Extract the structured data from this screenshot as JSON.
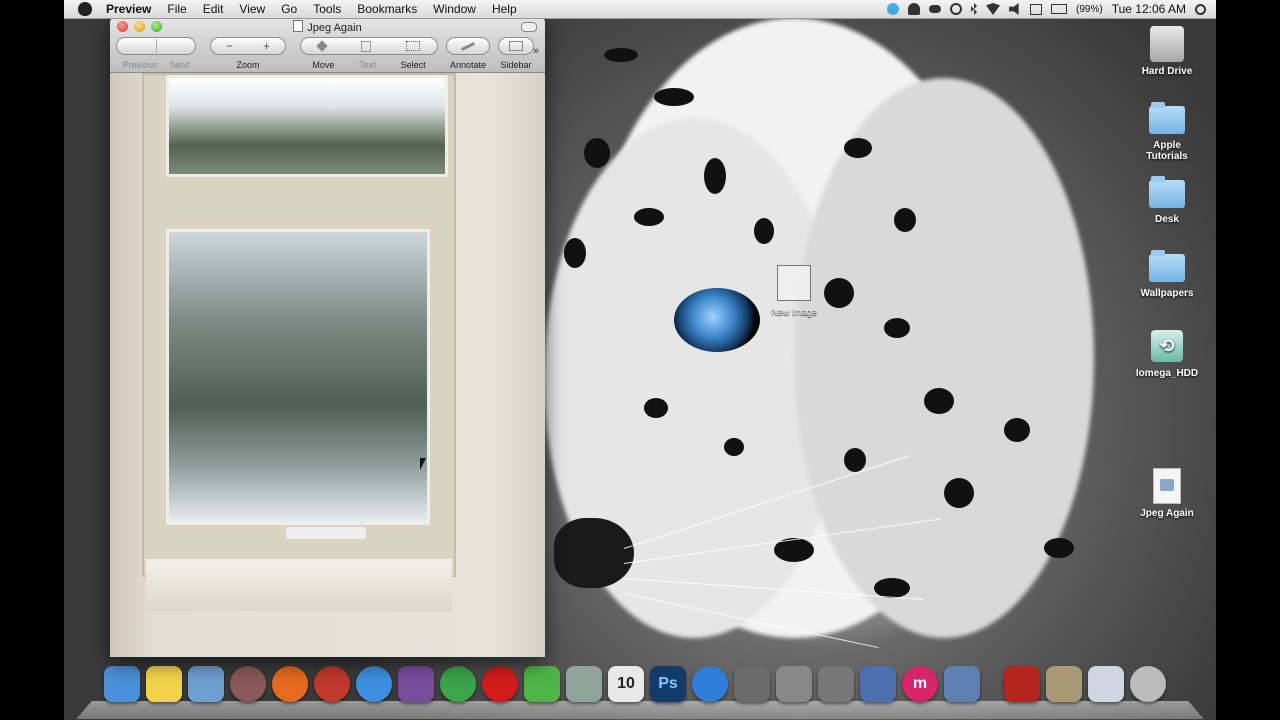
{
  "menubar": {
    "app": "Preview",
    "items": [
      "File",
      "Edit",
      "View",
      "Go",
      "Tools",
      "Bookmarks",
      "Window",
      "Help"
    ],
    "battery": "(99%)",
    "clock": "Tue 12:06 AM"
  },
  "window": {
    "title": "Jpeg Again",
    "toolbar": {
      "previous": "Previous",
      "next": "Next",
      "zoom": "Zoom",
      "zoom_out_glyph": "−",
      "zoom_in_glyph": "+",
      "move": "Move",
      "text": "Text",
      "select": "Select",
      "annotate": "Annotate",
      "sidebar": "Sidebar",
      "overflow": "»"
    }
  },
  "desktop": {
    "icons": [
      {
        "label": "Hard Drive",
        "kind": "drive"
      },
      {
        "label": "Apple Tutorials",
        "kind": "folder"
      },
      {
        "label": "Desk",
        "kind": "folder"
      },
      {
        "label": "Wallpapers",
        "kind": "folder"
      },
      {
        "label": "Iomega_HDD",
        "kind": "timemachine"
      },
      {
        "label": "Jpeg Again",
        "kind": "file"
      }
    ],
    "dragged_item": "New Image"
  },
  "dock": {
    "apps": [
      {
        "name": "finder-icon",
        "color": "#4a90d9"
      },
      {
        "name": "stickies-icon",
        "color": "#f2d34a"
      },
      {
        "name": "preview-icon",
        "color": "#6f9fd0"
      },
      {
        "name": "itunes-dvd-icon",
        "color": "#8a5a5a"
      },
      {
        "name": "firefox-icon",
        "color": "#e66a1f"
      },
      {
        "name": "half-life-icon",
        "color": "#c0392b"
      },
      {
        "name": "safari-icon",
        "color": "#3f8fe0"
      },
      {
        "name": "tor-icon",
        "color": "#7a4d9c"
      },
      {
        "name": "chrome-icon",
        "color": "#3aa54a"
      },
      {
        "name": "opera-icon",
        "color": "#d21b1b"
      },
      {
        "name": "leaf-icon",
        "color": "#4fb548"
      },
      {
        "name": "activity-icon",
        "color": "#8fa39a"
      },
      {
        "name": "calendar-icon",
        "color": "#e8e8e8"
      },
      {
        "name": "photoshop-icon",
        "color": "#123a6b"
      },
      {
        "name": "itunes-icon",
        "color": "#2f7fd8"
      },
      {
        "name": "iphoto-icon",
        "color": "#6b6b6b"
      },
      {
        "name": "tools-icon",
        "color": "#888888"
      },
      {
        "name": "system-prefs-icon",
        "color": "#777777"
      },
      {
        "name": "pen-icon",
        "color": "#4d6fb0"
      },
      {
        "name": "m-app-icon",
        "color": "#d8246a"
      },
      {
        "name": "preview2-icon",
        "color": "#5d7fb2"
      },
      {
        "name": "red-app-icon",
        "color": "#b3261e"
      },
      {
        "name": "scanner-icon",
        "color": "#a89a75"
      },
      {
        "name": "table-icon",
        "color": "#cfd6df"
      },
      {
        "name": "trash-icon",
        "color": "#bbbbbb"
      }
    ],
    "calendar_day": "10",
    "ps_text": "Ps",
    "m_text": "m"
  }
}
